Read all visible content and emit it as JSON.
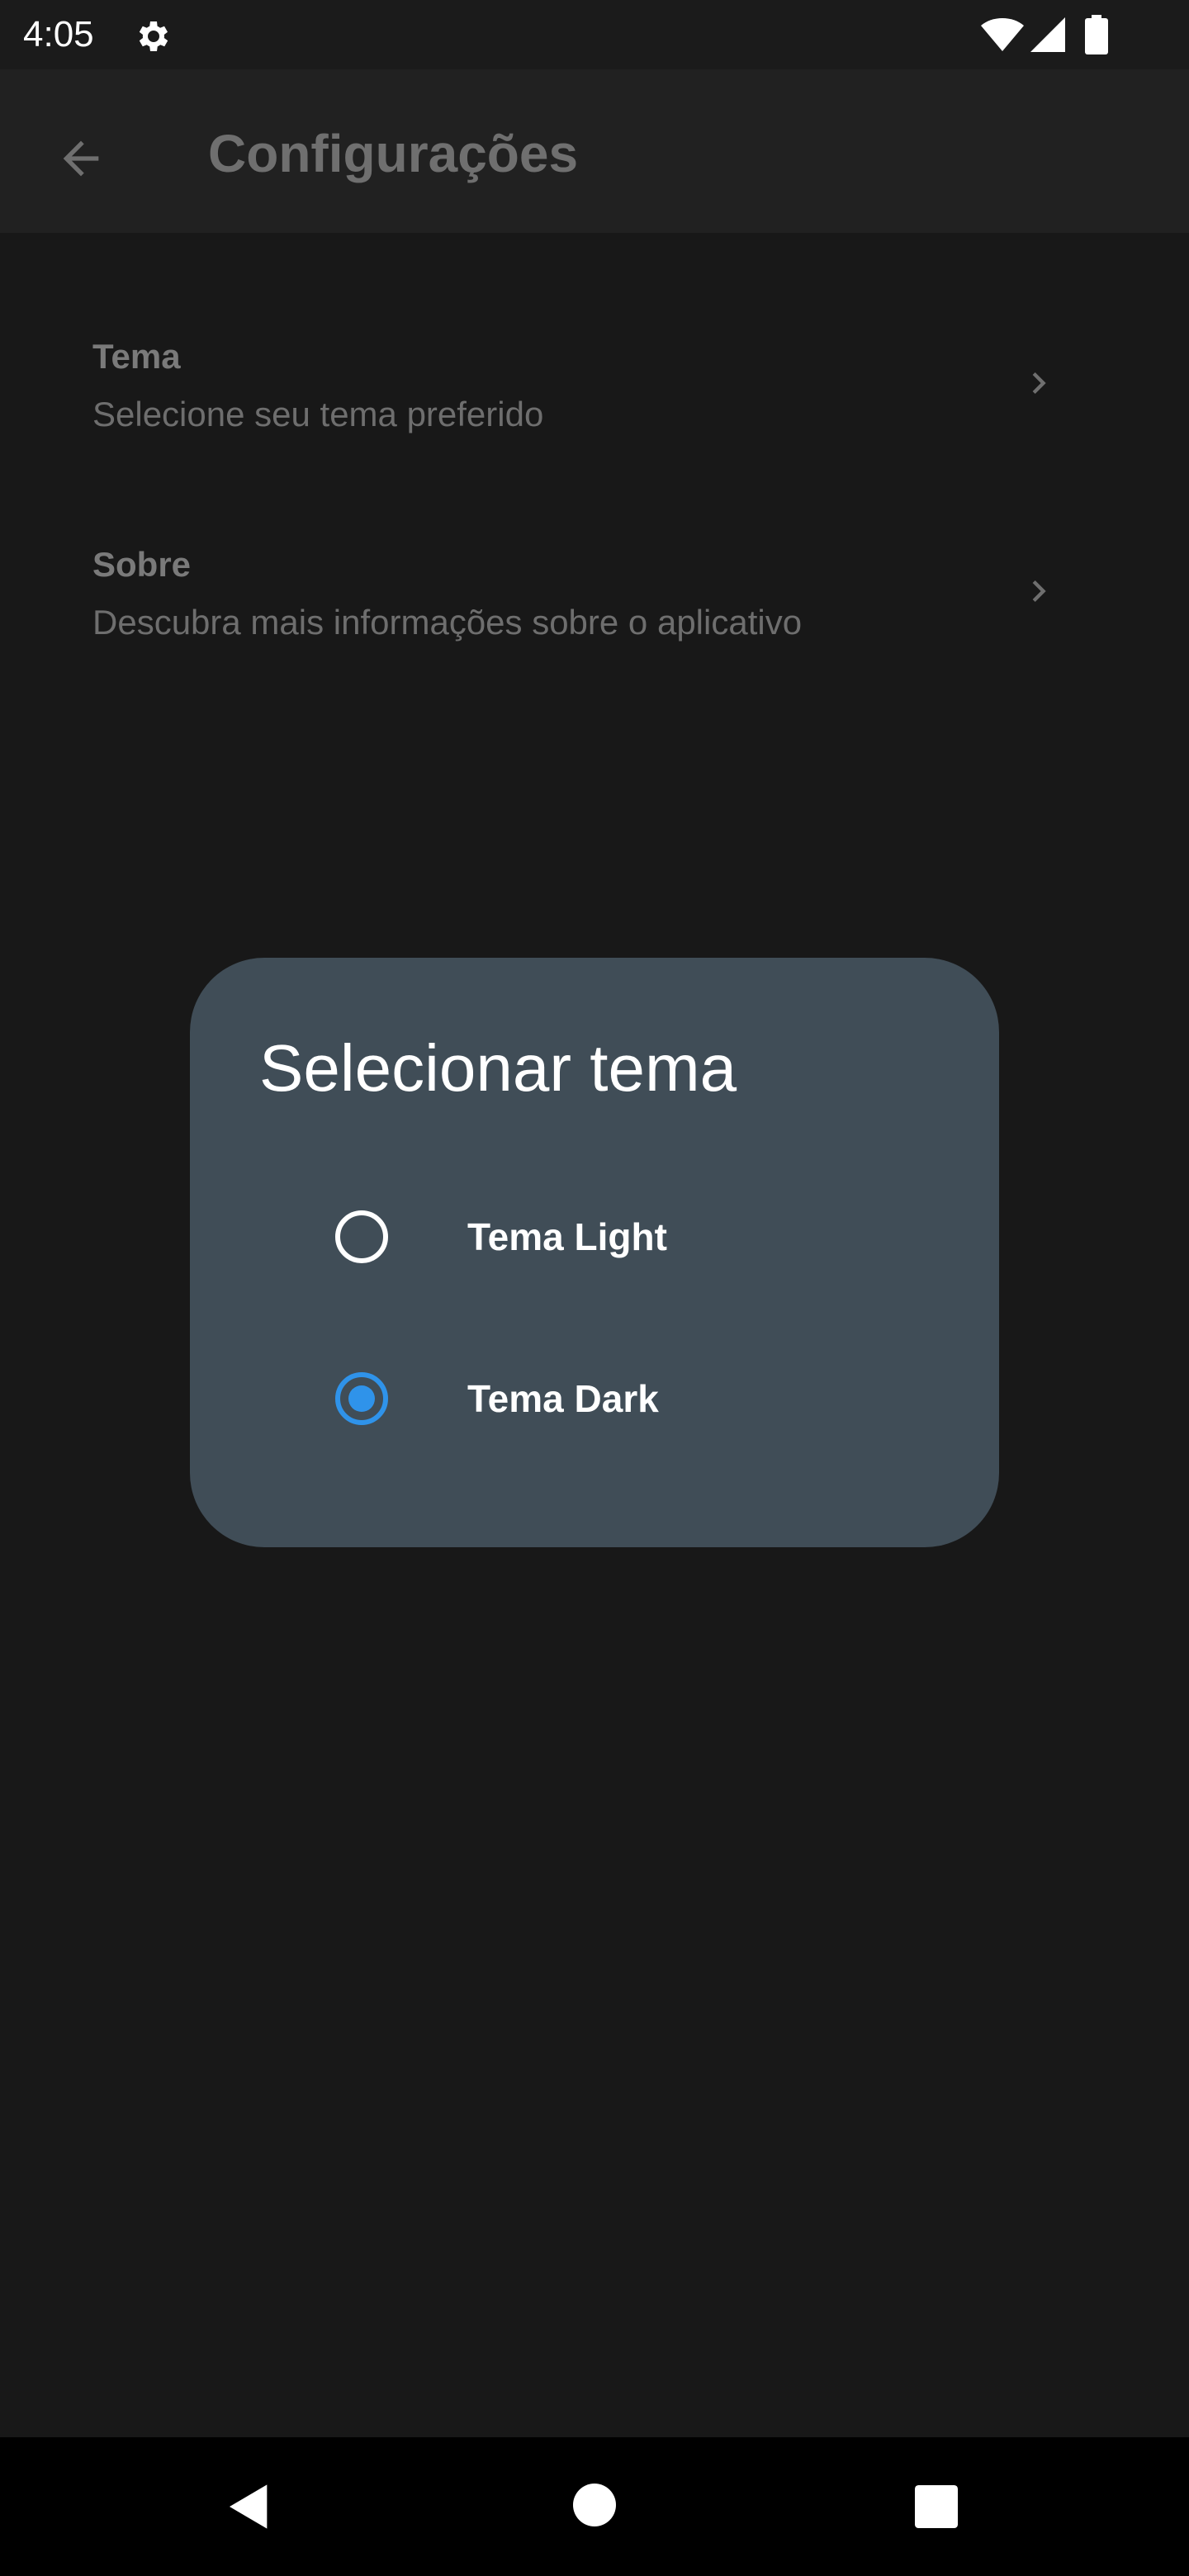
{
  "status_bar": {
    "time": "4:05",
    "icons": [
      "gear-icon",
      "wifi-icon",
      "signal-icon",
      "battery-icon"
    ]
  },
  "app_bar": {
    "title": "Configurações",
    "back_icon": "arrow-left-icon"
  },
  "settings": {
    "items": [
      {
        "title": "Tema",
        "subtitle": "Selecione seu tema preferido",
        "icon": "chevron-right-icon"
      },
      {
        "title": "Sobre",
        "subtitle": "Descubra mais informações sobre o aplicativo",
        "icon": "chevron-right-icon"
      }
    ]
  },
  "dialog": {
    "title": "Selecionar tema",
    "options": [
      {
        "label": "Tema Light",
        "selected": false
      },
      {
        "label": "Tema Dark",
        "selected": true
      }
    ]
  },
  "nav_bar": {
    "icons": [
      "nav-back-icon",
      "nav-home-icon",
      "nav-recents-icon"
    ]
  },
  "colors": {
    "accent": "#2f93ea",
    "dialog_bg": "#404d57",
    "screen_bg": "#181818",
    "app_bar_bg": "#212121"
  }
}
